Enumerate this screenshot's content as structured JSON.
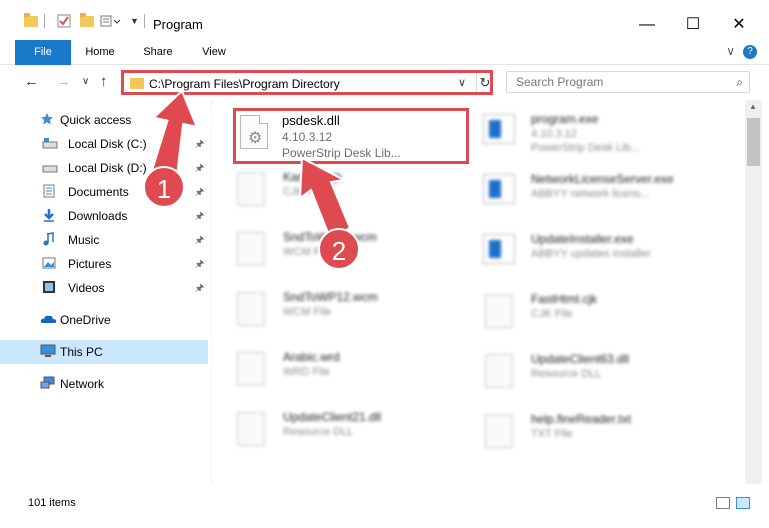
{
  "window": {
    "title": "Program",
    "minimize": "—",
    "maximize": "☐",
    "close": "✕"
  },
  "ribbon": {
    "tabs": [
      "File",
      "Home",
      "Share",
      "View"
    ],
    "expand": "∨",
    "help": "?"
  },
  "nav": {
    "back": "←",
    "forward": "→",
    "recent": "∨",
    "up": "↑",
    "address": "C:\\Program Files\\Program Directory",
    "address_dropdown": "∨",
    "refresh": "↻",
    "search_placeholder": "Search Program",
    "search_icon": "⌕"
  },
  "sidebar": {
    "quick_access": "Quick access",
    "items": [
      {
        "label": "Local Disk (C:)",
        "icon": "drive-icon"
      },
      {
        "label": "Local Disk (D:)",
        "icon": "drive-icon"
      },
      {
        "label": "Documents",
        "icon": "documents-icon"
      },
      {
        "label": "Downloads",
        "icon": "downloads-icon"
      },
      {
        "label": "Music",
        "icon": "music-icon"
      },
      {
        "label": "Pictures",
        "icon": "pictures-icon"
      },
      {
        "label": "Videos",
        "icon": "videos-icon"
      }
    ],
    "pin": "📌",
    "onedrive": "OneDrive",
    "this_pc": "This PC",
    "network": "Network"
  },
  "files": {
    "highlighted": {
      "name": "psdesk.dll",
      "version": "4.10.3.12",
      "description": "PowerStrip Desk Lib..."
    },
    "left_column": [
      {
        "name": "Kanban.cjk",
        "type": "CJK File"
      },
      {
        "name": "SndToWP11.wcm",
        "type": "WCM File"
      },
      {
        "name": "SndToWP12.wcm",
        "type": "WCM File"
      },
      {
        "name": "Arabic.wrd",
        "type": "WRD File"
      },
      {
        "name": "UpdateClient21.dll",
        "type": "Resource DLL"
      }
    ],
    "right_column": [
      {
        "name": "program.exe",
        "type": "4.10.3.12",
        "extra": "PowerStrip Desk Lib..."
      },
      {
        "name": "NetworkLicenseServer.exe",
        "type": "ABBYY network licens..."
      },
      {
        "name": "UpdateInstaller.exe",
        "type": "ABBYY updates installer"
      },
      {
        "name": "FastHtml.cjk",
        "type": "CJK File"
      },
      {
        "name": "UpdateClient63.dll",
        "type": "Resource DLL"
      },
      {
        "name": "help.fineReader.txt",
        "type": "TXT File"
      }
    ]
  },
  "status": {
    "count": "101 items"
  },
  "callouts": {
    "one": "1",
    "two": "2"
  },
  "colors": {
    "accent": "#1979ca",
    "highlight": "#de4a4f",
    "selected": "#cce8ff"
  }
}
